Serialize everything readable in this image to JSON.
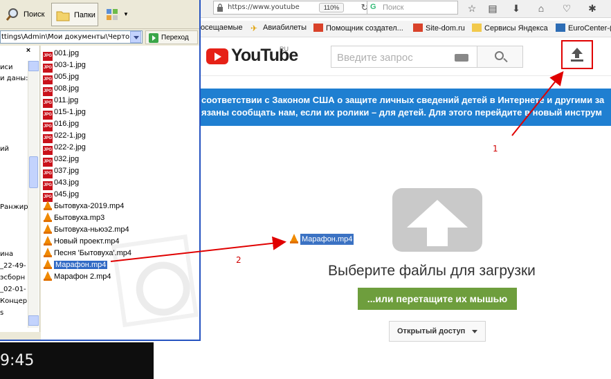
{
  "explorer": {
    "search_label": "Поиск",
    "folders_label": "Папки",
    "address": "ttings\\Admin\\Мои документы\\Чертов",
    "go_label": "Переход",
    "close_symbol": "×",
    "tree_items": [
      "иси",
      "и даны:",
      "",
      "",
      "ий",
      "",
      "",
      "",
      "Ранжиро",
      "",
      "",
      "ина",
      "_22-49-",
      "эсборн Ц",
      "_02-01-",
      "Концер",
      "s"
    ],
    "files": [
      {
        "name": "001.jpg",
        "type": "jpg"
      },
      {
        "name": "003-1.jpg",
        "type": "jpg"
      },
      {
        "name": "005.jpg",
        "type": "jpg"
      },
      {
        "name": "008.jpg",
        "type": "jpg"
      },
      {
        "name": "011.jpg",
        "type": "jpg"
      },
      {
        "name": "015-1.jpg",
        "type": "jpg"
      },
      {
        "name": "016.jpg",
        "type": "jpg"
      },
      {
        "name": "022-1.jpg",
        "type": "jpg"
      },
      {
        "name": "022-2.jpg",
        "type": "jpg"
      },
      {
        "name": "032.jpg",
        "type": "jpg"
      },
      {
        "name": "037.jpg",
        "type": "jpg"
      },
      {
        "name": "043.jpg",
        "type": "jpg"
      },
      {
        "name": "045.jpg",
        "type": "jpg"
      },
      {
        "name": "Бытовуха-2019.mp4",
        "type": "vlc"
      },
      {
        "name": "Бытовуха.mp3",
        "type": "vlc"
      },
      {
        "name": "Бытовуха-ньюэ2.mp4",
        "type": "vlc"
      },
      {
        "name": "Новый проект.mp4",
        "type": "vlc"
      },
      {
        "name": "Песня 'Бытовуха'.mp4",
        "type": "vlc"
      },
      {
        "name": "Марафон.mp4",
        "type": "vlc",
        "selected": true
      },
      {
        "name": "Марафон 2.mp4",
        "type": "vlc"
      }
    ]
  },
  "video_strip": {
    "time": "9:45"
  },
  "browser": {
    "url": "https://www.youtube",
    "zoom": "110%",
    "search_placeholder": "Поиск",
    "bookmarks": [
      "осещаемые",
      "Авиабилеты",
      "Помощник создател...",
      "Site-dom.ru",
      "Сервисы Яндекса",
      "EuroCenter-("
    ]
  },
  "youtube": {
    "logo_word": "YouTube",
    "logo_region": "RU",
    "search_placeholder": "Введите запрос",
    "notice_line1": "соответствии с Законом США о защите личных сведений детей в Интернете и другими за",
    "notice_line2": "язаны сообщать нам, если их ролики – для детей. Для этого перейдите в новый инструм",
    "upload_title": "Выберите файлы для загрузки",
    "drag_button": "...или перетащите их мышью",
    "privacy_button": "Открытый доступ"
  },
  "drag_ghost": {
    "label": "Марафон.mp4"
  },
  "annotations": {
    "label1": "1",
    "label2": "2",
    "color": "#e00000"
  }
}
